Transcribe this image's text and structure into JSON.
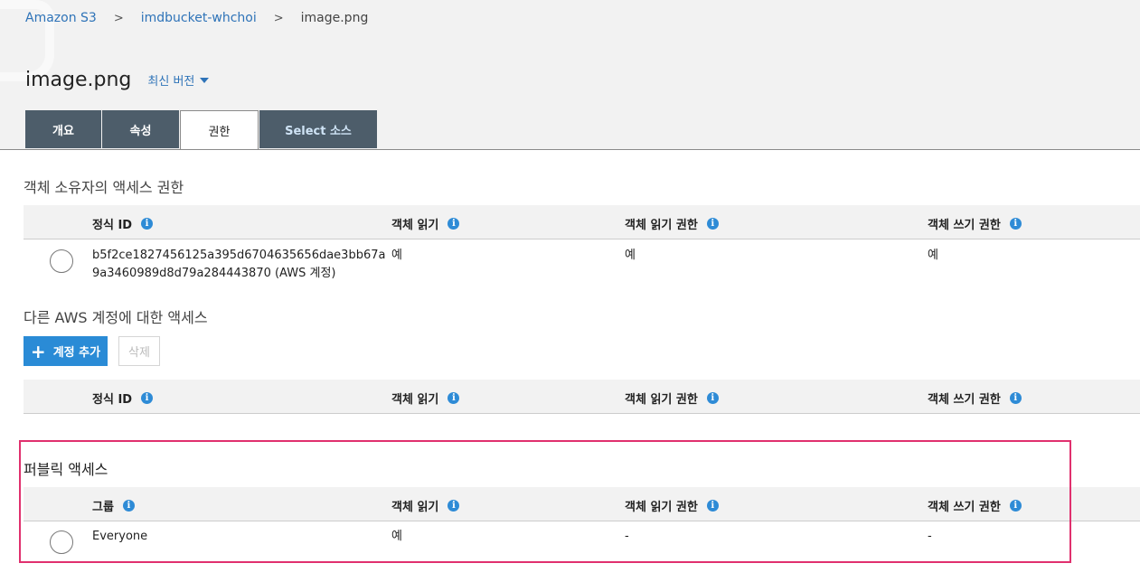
{
  "breadcrumb": {
    "root": "Amazon S3",
    "bucket": "imdbucket-whchoi",
    "current": "image.png",
    "separator": ">"
  },
  "header": {
    "title": "image.png",
    "version_label": "최신 버전"
  },
  "tabs": [
    {
      "label": "개요"
    },
    {
      "label": "속성"
    },
    {
      "label": "권한"
    },
    {
      "label": "Select 소스"
    }
  ],
  "owner_section": {
    "title": "객체 소유자의 액세스 권한",
    "columns": [
      "정식 ID",
      "객체 읽기",
      "객체 읽기 권한",
      "객체 쓰기 권한"
    ],
    "row": {
      "id_line1": "b5f2ce1827456125a395d6704635656dae3bb67a",
      "id_line2": "9a3460989d8d79a284443870 (AWS 계정)",
      "read": "예",
      "read_acl": "예",
      "write_acl": "예"
    }
  },
  "other_accounts_section": {
    "title": "다른 AWS 계정에 대한 액세스",
    "add_button": "계정 추가",
    "delete_button": "삭제",
    "columns": [
      "정식 ID",
      "객체 읽기",
      "객체 읽기 권한",
      "객체 쓰기 권한"
    ]
  },
  "public_section": {
    "title": "퍼블릭 액세스",
    "columns": [
      "그룹",
      "객체 읽기",
      "객체 읽기 권한",
      "객체 쓰기 권한"
    ],
    "row": {
      "group": "Everyone",
      "read": "예",
      "read_acl": "-",
      "write_acl": "-"
    }
  },
  "colors": {
    "link": "#2e73b8",
    "tab_bg": "#4d5d6a",
    "primary_button": "#2a8bd6",
    "highlight": "#e0306e"
  }
}
